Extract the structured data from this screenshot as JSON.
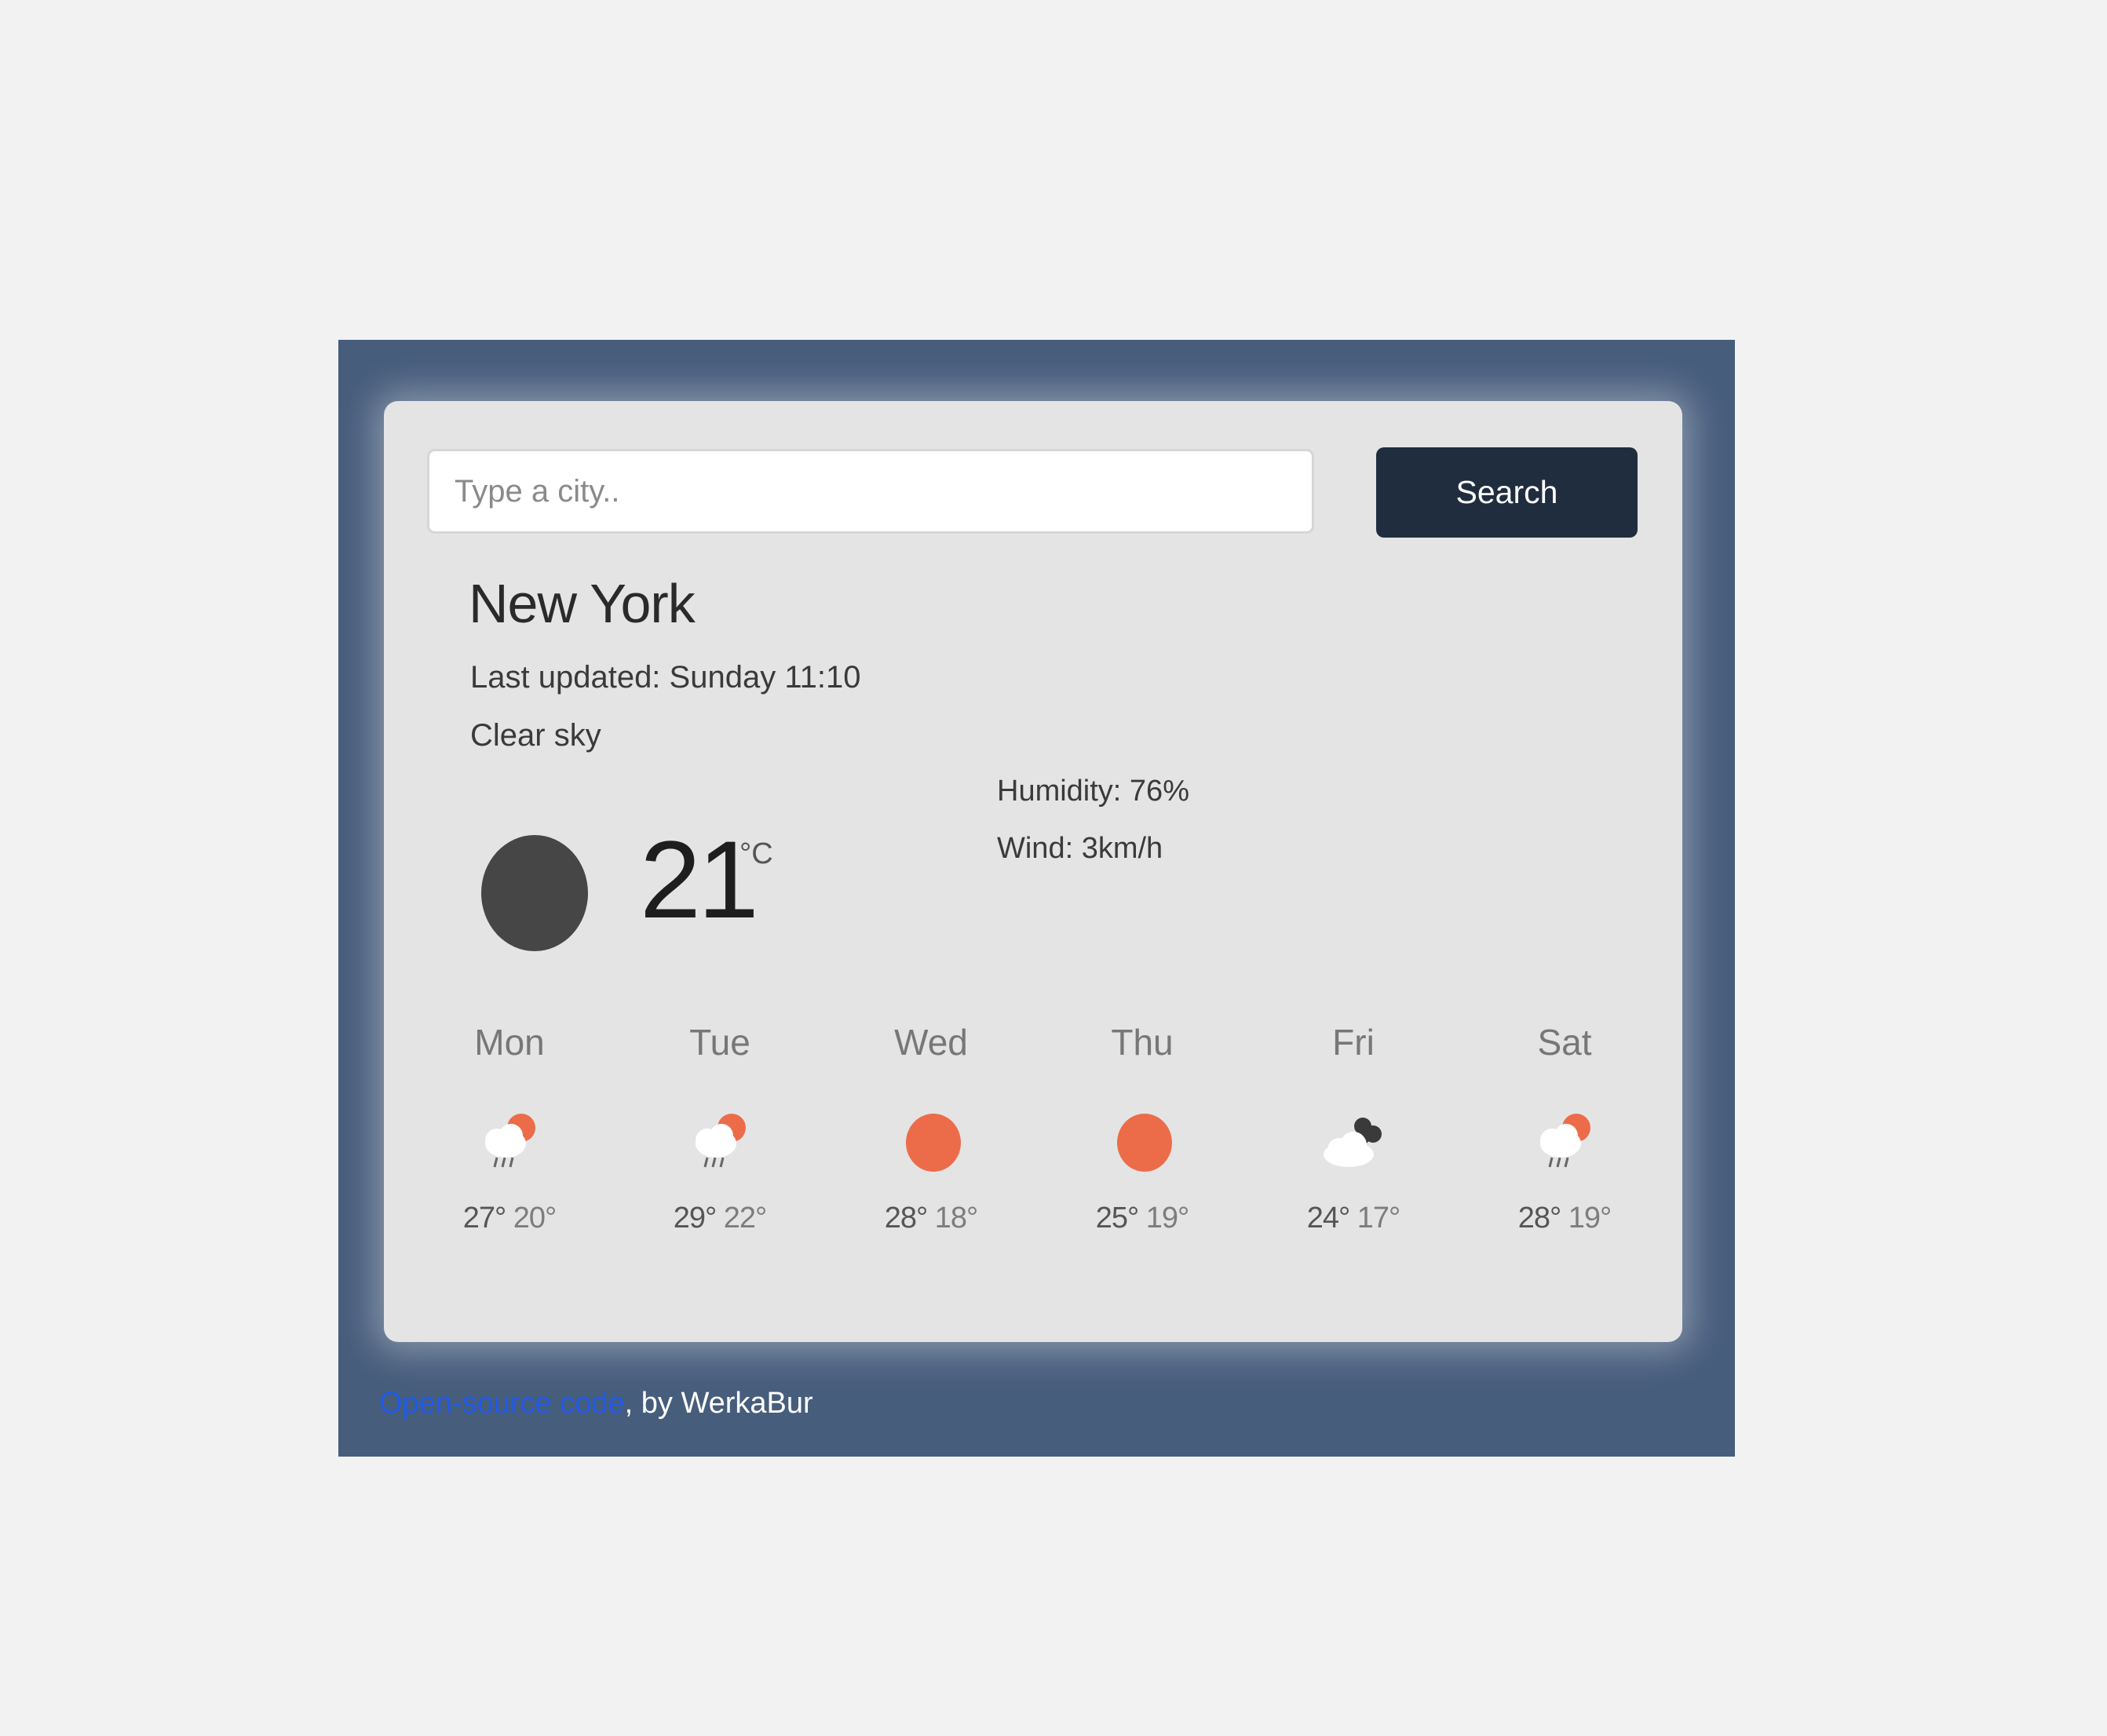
{
  "search": {
    "placeholder": "Type a city..",
    "button_label": "Search"
  },
  "current": {
    "city": "New York",
    "last_updated": "Last updated: Sunday 11:10",
    "description": "Clear sky",
    "temperature": "21",
    "unit": "°C",
    "humidity": "Humidity: 76%",
    "wind": "Wind: 3km/h",
    "icon": "moon-icon"
  },
  "forecast": [
    {
      "day": "Mon",
      "max": "27°",
      "min": "20°",
      "icon": "rain-sun-icon"
    },
    {
      "day": "Tue",
      "max": "29°",
      "min": "22°",
      "icon": "rain-sun-icon"
    },
    {
      "day": "Wed",
      "max": "28°",
      "min": "18°",
      "icon": "sun-icon"
    },
    {
      "day": "Thu",
      "max": "25°",
      "min": "19°",
      "icon": "sun-icon"
    },
    {
      "day": "Fri",
      "max": "24°",
      "min": "17°",
      "icon": "cloudy-icon"
    },
    {
      "day": "Sat",
      "max": "28°",
      "min": "19°",
      "icon": "rain-sun-icon"
    }
  ],
  "footer": {
    "link_text": "Open-source code",
    "byline": ", by WerkaBur"
  },
  "colors": {
    "frame": "#475d7c",
    "card": "#e4e4e4",
    "button": "#202d3f",
    "sun": "#ec6c4a",
    "link": "#1f5ae8"
  }
}
